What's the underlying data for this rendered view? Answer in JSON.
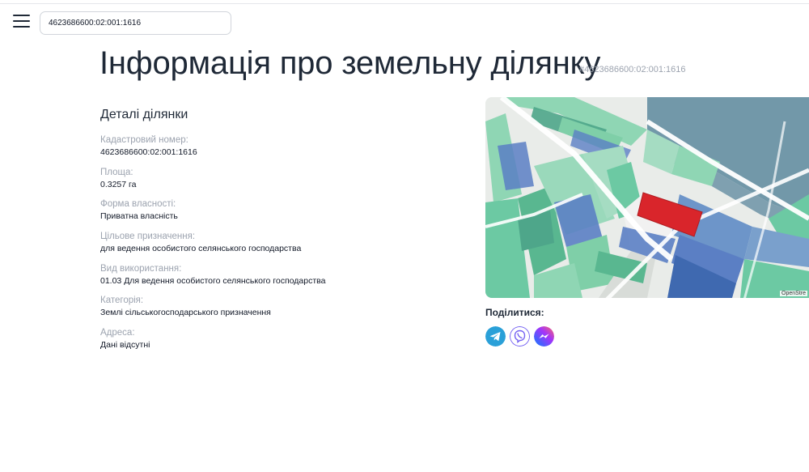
{
  "search": {
    "value": "4623686600:02:001:1616"
  },
  "page": {
    "title": "Інформація про земельну ділянку",
    "title_id": "#4623686600:02:001:1616"
  },
  "details": {
    "heading": "Деталі ділянки",
    "fields": [
      {
        "label": "Кадастровий номер:",
        "value": "4623686600:02:001:1616"
      },
      {
        "label": "Площа:",
        "value": "0.3257 га"
      },
      {
        "label": "Форма власності:",
        "value": "Приватна власність"
      },
      {
        "label": "Цільове призначення:",
        "value": "для ведення особистого селянського господарства"
      },
      {
        "label": "Вид використання:",
        "value": "01.03 Для ведення особистого селянського господарства"
      },
      {
        "label": "Категорія:",
        "value": "Землі сільськогосподарського призначення"
      },
      {
        "label": "Адреса:",
        "value": "Дані відсутні"
      }
    ]
  },
  "map": {
    "attribution": "OpenStre"
  },
  "share": {
    "label": "Поділитися:",
    "icons": [
      "telegram-icon",
      "viber-icon",
      "messenger-icon"
    ],
    "colors": {
      "telegram": "#2aa0d8",
      "viber": "#7360f2",
      "messenger": "#a334fa"
    }
  },
  "colors": {
    "highlight_parcel": "#d9252b",
    "parcel_green": "#6cc9a3",
    "parcel_blue": "#5b7fc4"
  }
}
